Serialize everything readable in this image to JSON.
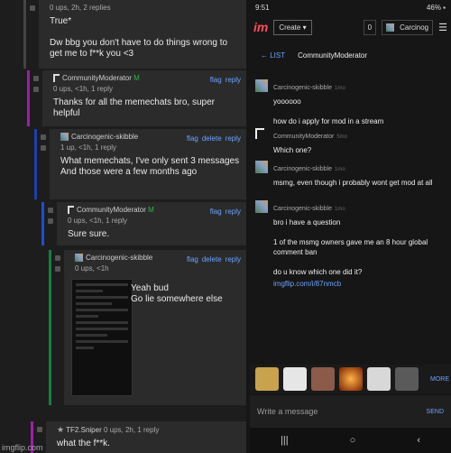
{
  "left": {
    "comments": [
      {
        "user": "",
        "meta": "0 ups, 2h, 2 replies",
        "text": "True*\n\nDw bbg you don't have to do things wrong to get me to f**k you <3",
        "actions": []
      },
      {
        "user": "CommunityModerator",
        "badge": "M",
        "meta": "0 ups, <1h, 1 reply",
        "text": "Thanks for all the memechats bro, super helpful",
        "actions": [
          "flag",
          "reply"
        ]
      },
      {
        "user": "Carcinogenic-skibble",
        "meta": "1 up, <1h, 1 reply",
        "text": "What memechats, I've only sent 3 messages\nAnd those were a few months ago",
        "actions": [
          "flag",
          "delete",
          "reply"
        ]
      },
      {
        "user": "CommunityModerator",
        "badge": "M",
        "meta": "0 ups, <1h, 1 reply",
        "text": "Sure sure.",
        "actions": [
          "flag",
          "reply"
        ]
      },
      {
        "user": "Carcinogenic-skibble",
        "meta": "0 ups, <1h",
        "text": "Yeah bud\nGo lie somewhere else",
        "actions": [
          "flag",
          "delete",
          "reply"
        ]
      },
      {
        "user": "TF2.Sniper",
        "meta": "0 ups, 2h, 1 reply",
        "text": "what the f**k.",
        "actions": []
      }
    ]
  },
  "right": {
    "status_time": "9:51",
    "status_right": "46% ▪",
    "logo": "im",
    "create_label": "Create ▾",
    "count": "0",
    "username": "Carcinog",
    "list_label": "← LIST",
    "conversation_name": "CommunityModerator",
    "messages": [
      {
        "name": "Carcinogenic-skibble",
        "time": "1mo",
        "lines": "yoooooo\n\nhow do i apply for mod in a stream",
        "avatar": "cs"
      },
      {
        "name": "CommunityModerator",
        "time": "5mo",
        "lines": "Which one?",
        "avatar": "cm"
      },
      {
        "name": "Carcinogenic-skibble",
        "time": "1mo",
        "lines": "msmg, even though i probably wont get mod at all",
        "avatar": "cs"
      },
      {
        "name": "Carcinogenic-skibble",
        "time": "1mo",
        "lines": "bro i have a question\n\n1 of the msmg owners gave me an 8 hour global comment ban\n\ndo u know which one did it?",
        "link": "imgflip.com/i/87nmcb",
        "avatar": "cs"
      }
    ],
    "more_label": "MORE",
    "input_placeholder": "Write a message",
    "send_label": "SEND"
  },
  "watermark": "imgflip.com"
}
